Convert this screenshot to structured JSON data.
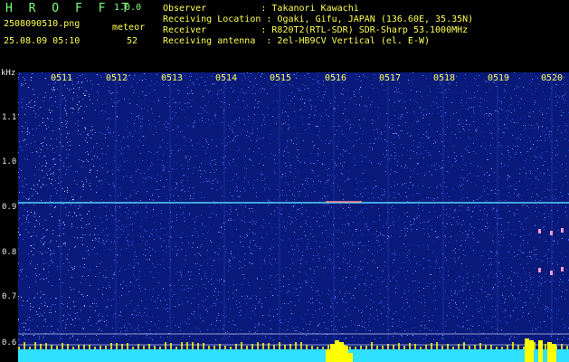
{
  "app": {
    "title": "H R O F F T",
    "version": "1.0.0",
    "file_name": "2508090510.png",
    "date_time": "25.08.09 05:10",
    "meteor_label": "meteor",
    "meteor_count": "52"
  },
  "info": {
    "observer": "Observer          : Takanori Kawachi",
    "location": "Receiving Location : Ogaki, Gifu, JAPAN (136.60E, 35.35N)",
    "receiver": "Receiver          : R820T2(RTL-SDR) SDR-Sharp 53.1000MHz",
    "antenna": "Receiving antenna  : 2el-HB9CV Vertical (el. E-W)"
  },
  "axes": {
    "y_unit": "kHz",
    "x_ticks": [
      "0511",
      "0512",
      "0513",
      "0514",
      "0515",
      "0516",
      "0517",
      "0518",
      "0519",
      "0520"
    ],
    "y_ticks": [
      "1.1",
      "1.0",
      "0.9",
      "0.8",
      "0.7",
      "0.6"
    ]
  },
  "colors": {
    "background": "#000000",
    "spectrum_bg": "#0a1a7a",
    "header_green": "#7cff7c",
    "header_yellow": "#ffff55",
    "signal_line": "#4fd6ff",
    "baseline": "#2fe0ff",
    "peak": "#ffff00"
  }
}
